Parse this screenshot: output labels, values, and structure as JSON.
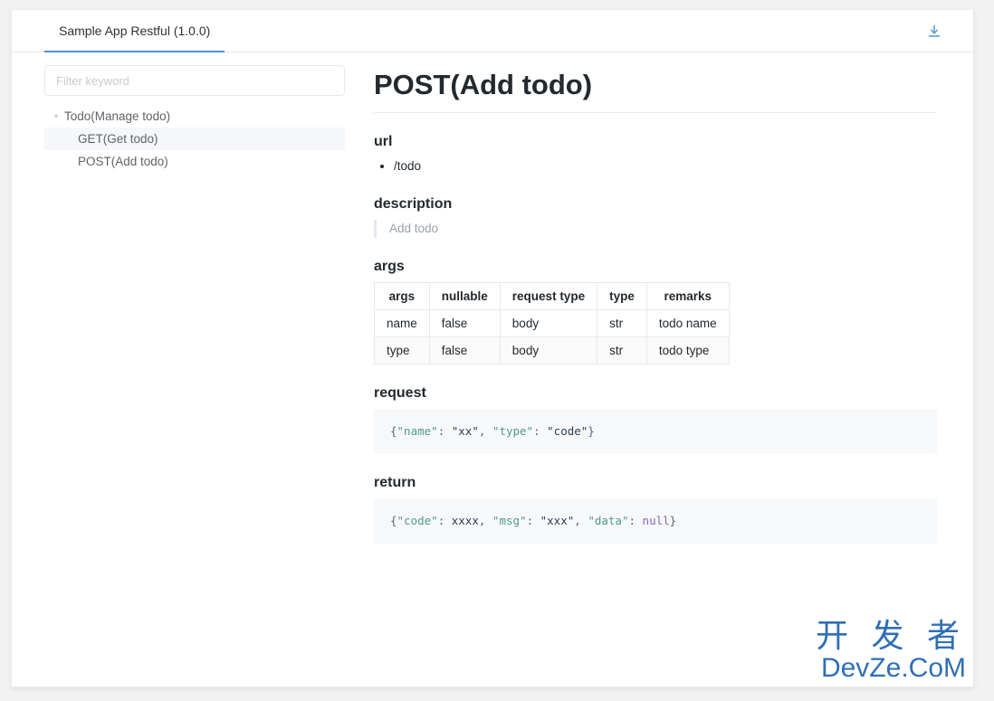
{
  "window": {
    "download_icon": "download-icon"
  },
  "tabs": [
    {
      "label": "Sample App Restful (1.0.0)",
      "active": true
    }
  ],
  "sidebar": {
    "filter": {
      "placeholder": "Filter keyword",
      "value": ""
    },
    "tree": [
      {
        "label": "Todo(Manage todo)",
        "level": 0,
        "caret": "▾",
        "selected": false
      },
      {
        "label": "GET(Get todo)",
        "level": 1,
        "caret": "",
        "selected": true
      },
      {
        "label": "POST(Add todo)",
        "level": 1,
        "caret": "",
        "selected": false
      }
    ]
  },
  "doc": {
    "title": "POST(Add todo)",
    "sections": {
      "url_heading": "url",
      "url_items": [
        "/todo"
      ],
      "description_heading": "description",
      "description_text": "Add todo",
      "args_heading": "args",
      "request_heading": "request",
      "return_heading": "return"
    },
    "args_table": {
      "columns": [
        "args",
        "nullable",
        "request type",
        "type",
        "remarks"
      ],
      "rows": [
        [
          "name",
          "false",
          "body",
          "str",
          "todo name"
        ],
        [
          "type",
          "false",
          "body",
          "str",
          "todo type"
        ]
      ]
    },
    "request_code": {
      "tokens": [
        {
          "t": "punct",
          "v": "{"
        },
        {
          "t": "key",
          "v": "\"name\""
        },
        {
          "t": "punct",
          "v": ": "
        },
        {
          "t": "str",
          "v": "\"xx\""
        },
        {
          "t": "punct",
          "v": ", "
        },
        {
          "t": "key",
          "v": "\"type\""
        },
        {
          "t": "punct",
          "v": ": "
        },
        {
          "t": "str",
          "v": "\"code\""
        },
        {
          "t": "punct",
          "v": "}"
        }
      ],
      "text": "{\"name\": \"xx\", \"type\": \"code\"}"
    },
    "return_code": {
      "tokens": [
        {
          "t": "punct",
          "v": "{"
        },
        {
          "t": "key",
          "v": "\"code\""
        },
        {
          "t": "punct",
          "v": ": "
        },
        {
          "t": "str",
          "v": "xxxx"
        },
        {
          "t": "punct",
          "v": ", "
        },
        {
          "t": "key",
          "v": "\"msg\""
        },
        {
          "t": "punct",
          "v": ": "
        },
        {
          "t": "str",
          "v": "\"xxx\""
        },
        {
          "t": "punct",
          "v": ", "
        },
        {
          "t": "key",
          "v": "\"data\""
        },
        {
          "t": "punct",
          "v": ": "
        },
        {
          "t": "lit",
          "v": "null"
        },
        {
          "t": "punct",
          "v": "}"
        }
      ],
      "text": "{\"code\": xxxx, \"msg\": \"xxx\", \"data\": null}"
    }
  },
  "watermark": {
    "line1": "开 发 者",
    "line2": "DevZe.CoM"
  },
  "colors": {
    "accent": "#4a90d9",
    "code_key": "#4e9a8d",
    "code_literal": "#8b63b8",
    "watermark": "#2f6fb5"
  }
}
